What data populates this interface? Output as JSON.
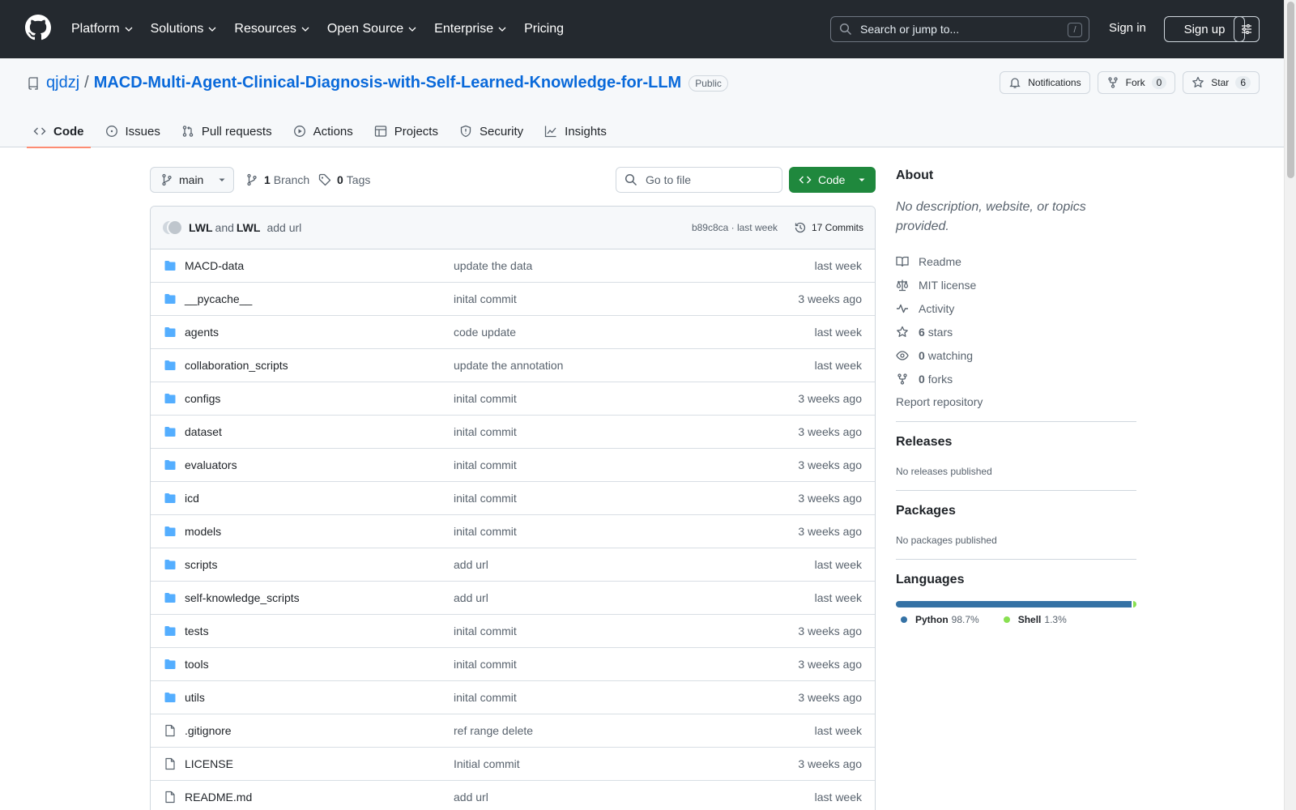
{
  "header": {
    "nav": [
      "Platform",
      "Solutions",
      "Resources",
      "Open Source",
      "Enterprise",
      "Pricing"
    ],
    "search_placeholder": "Search or jump to...",
    "search_shortcut": "/",
    "sign_in": "Sign in",
    "sign_up": "Sign up"
  },
  "repo": {
    "owner": "qjdzj",
    "separator": "/",
    "name": "MACD-Multi-Agent-Clinical-Diagnosis-with-Self-Learned-Knowledge-for-LLM",
    "visibility": "Public",
    "notifications_label": "Notifications",
    "fork_label": "Fork",
    "fork_count": "0",
    "star_label": "Star",
    "star_count": "6",
    "tabs": [
      "Code",
      "Issues",
      "Pull requests",
      "Actions",
      "Projects",
      "Security",
      "Insights"
    ]
  },
  "toolbar": {
    "branch": "main",
    "branch_count": "1",
    "branch_label": "Branch",
    "tag_count": "0",
    "tag_label": "Tags",
    "goto_placeholder": "Go to file",
    "code_button": "Code"
  },
  "commit": {
    "author1": "LWL",
    "and": "and",
    "author2": "LWL",
    "message": "add url",
    "meta": "b89c8ca · last week",
    "commits_count_label": "17 Commits"
  },
  "files": [
    {
      "type": "folder",
      "name": "MACD-data",
      "message": "update the data",
      "time": "last week"
    },
    {
      "type": "folder",
      "name": "__pycache__",
      "message": "inital commit",
      "time": "3 weeks ago"
    },
    {
      "type": "folder",
      "name": "agents",
      "message": "code update",
      "time": "last week"
    },
    {
      "type": "folder",
      "name": "collaboration_scripts",
      "message": "update the annotation",
      "time": "last week"
    },
    {
      "type": "folder",
      "name": "configs",
      "message": "inital commit",
      "time": "3 weeks ago"
    },
    {
      "type": "folder",
      "name": "dataset",
      "message": "inital commit",
      "time": "3 weeks ago"
    },
    {
      "type": "folder",
      "name": "evaluators",
      "message": "inital commit",
      "time": "3 weeks ago"
    },
    {
      "type": "folder",
      "name": "icd",
      "message": "inital commit",
      "time": "3 weeks ago"
    },
    {
      "type": "folder",
      "name": "models",
      "message": "inital commit",
      "time": "3 weeks ago"
    },
    {
      "type": "folder",
      "name": "scripts",
      "message": "add url",
      "time": "last week"
    },
    {
      "type": "folder",
      "name": "self-knowledge_scripts",
      "message": "add url",
      "time": "last week"
    },
    {
      "type": "folder",
      "name": "tests",
      "message": "inital commit",
      "time": "3 weeks ago"
    },
    {
      "type": "folder",
      "name": "tools",
      "message": "inital commit",
      "time": "3 weeks ago"
    },
    {
      "type": "folder",
      "name": "utils",
      "message": "inital commit",
      "time": "3 weeks ago"
    },
    {
      "type": "file",
      "name": ".gitignore",
      "message": "ref range delete",
      "time": "last week"
    },
    {
      "type": "file",
      "name": "LICENSE",
      "message": "Initial commit",
      "time": "3 weeks ago"
    },
    {
      "type": "file",
      "name": "README.md",
      "message": "add url",
      "time": "last week"
    }
  ],
  "sidebar": {
    "about_title": "About",
    "about_desc": "No description, website, or topics provided.",
    "readme": "Readme",
    "license": "MIT license",
    "activity": "Activity",
    "stars_count": "6",
    "stars_label": "stars",
    "watching_count": "0",
    "watching_label": "watching",
    "forks_count": "0",
    "forks_label": "forks",
    "report": "Report repository",
    "releases_title": "Releases",
    "releases_note": "No releases published",
    "packages_title": "Packages",
    "packages_note": "No packages published",
    "languages_title": "Languages",
    "languages": [
      {
        "name": "Python",
        "percent": "98.7%",
        "value": 98.7,
        "color": "#3572A5"
      },
      {
        "name": "Shell",
        "percent": "1.3%",
        "value": 1.3,
        "color": "#89e051"
      }
    ]
  },
  "colors": {
    "header_bg": "#24292f",
    "link": "#0969da",
    "code_button": "#1f883d",
    "active_tab_underline": "#fd8c73",
    "folder_icon": "#54aeff"
  }
}
